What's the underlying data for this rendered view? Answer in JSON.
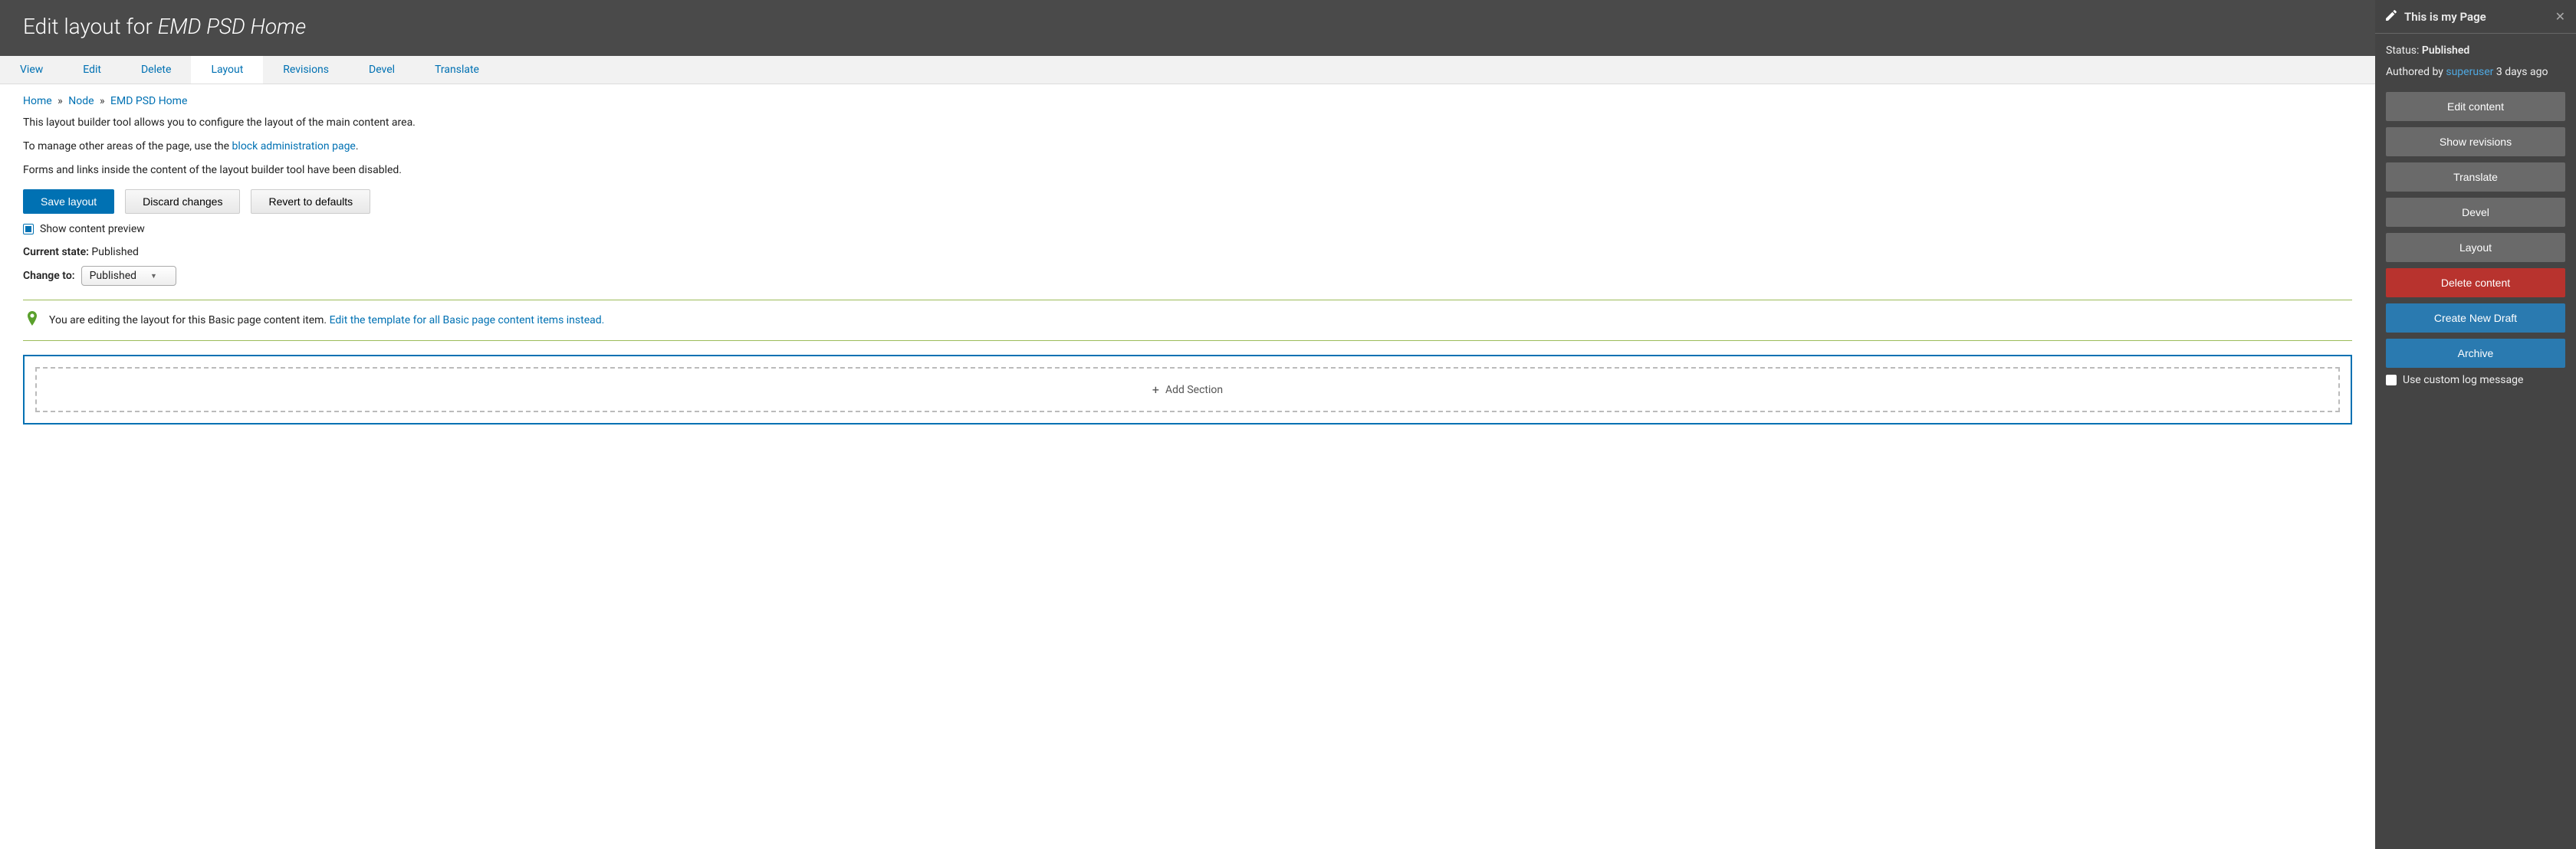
{
  "header": {
    "title_prefix": "Edit layout for ",
    "title_name": "EMD PSD Home"
  },
  "tabs": [
    {
      "label": "View",
      "active": false
    },
    {
      "label": "Edit",
      "active": false
    },
    {
      "label": "Delete",
      "active": false
    },
    {
      "label": "Layout",
      "active": true
    },
    {
      "label": "Revisions",
      "active": false
    },
    {
      "label": "Devel",
      "active": false
    },
    {
      "label": "Translate",
      "active": false
    }
  ],
  "breadcrumb": {
    "home": "Home",
    "sep": "»",
    "node": "Node",
    "current": "EMD PSD Home"
  },
  "description": {
    "line1": "This layout builder tool allows you to configure the layout of the main content area.",
    "line2_prefix": "To manage other areas of the page, use the ",
    "line2_link": "block administration page",
    "line2_suffix": ".",
    "line3": "Forms and links inside the content of the layout builder tool have been disabled."
  },
  "buttons": {
    "save": "Save layout",
    "discard": "Discard changes",
    "revert": "Revert to defaults"
  },
  "preview_checkbox": {
    "label": "Show content preview",
    "checked": true
  },
  "state": {
    "label": "Current state:",
    "value": "Published"
  },
  "change_to": {
    "label": "Change to:",
    "selected": "Published"
  },
  "notice": {
    "text": "You are editing the layout for this Basic page content item. ",
    "link": "Edit the template for all Basic page content items instead."
  },
  "layout": {
    "add_section": "Add Section"
  },
  "panel": {
    "title": "This is my Page",
    "status_label": "Status: ",
    "status_value": "Published",
    "authored_prefix": "Authored by ",
    "authored_user": "superuser",
    "authored_suffix": " 3 days ago",
    "buttons": {
      "edit": "Edit content",
      "revisions": "Show revisions",
      "translate": "Translate",
      "devel": "Devel",
      "layout": "Layout",
      "delete": "Delete content",
      "draft": "Create New Draft",
      "archive": "Archive"
    },
    "log_checkbox": "Use custom log message"
  }
}
